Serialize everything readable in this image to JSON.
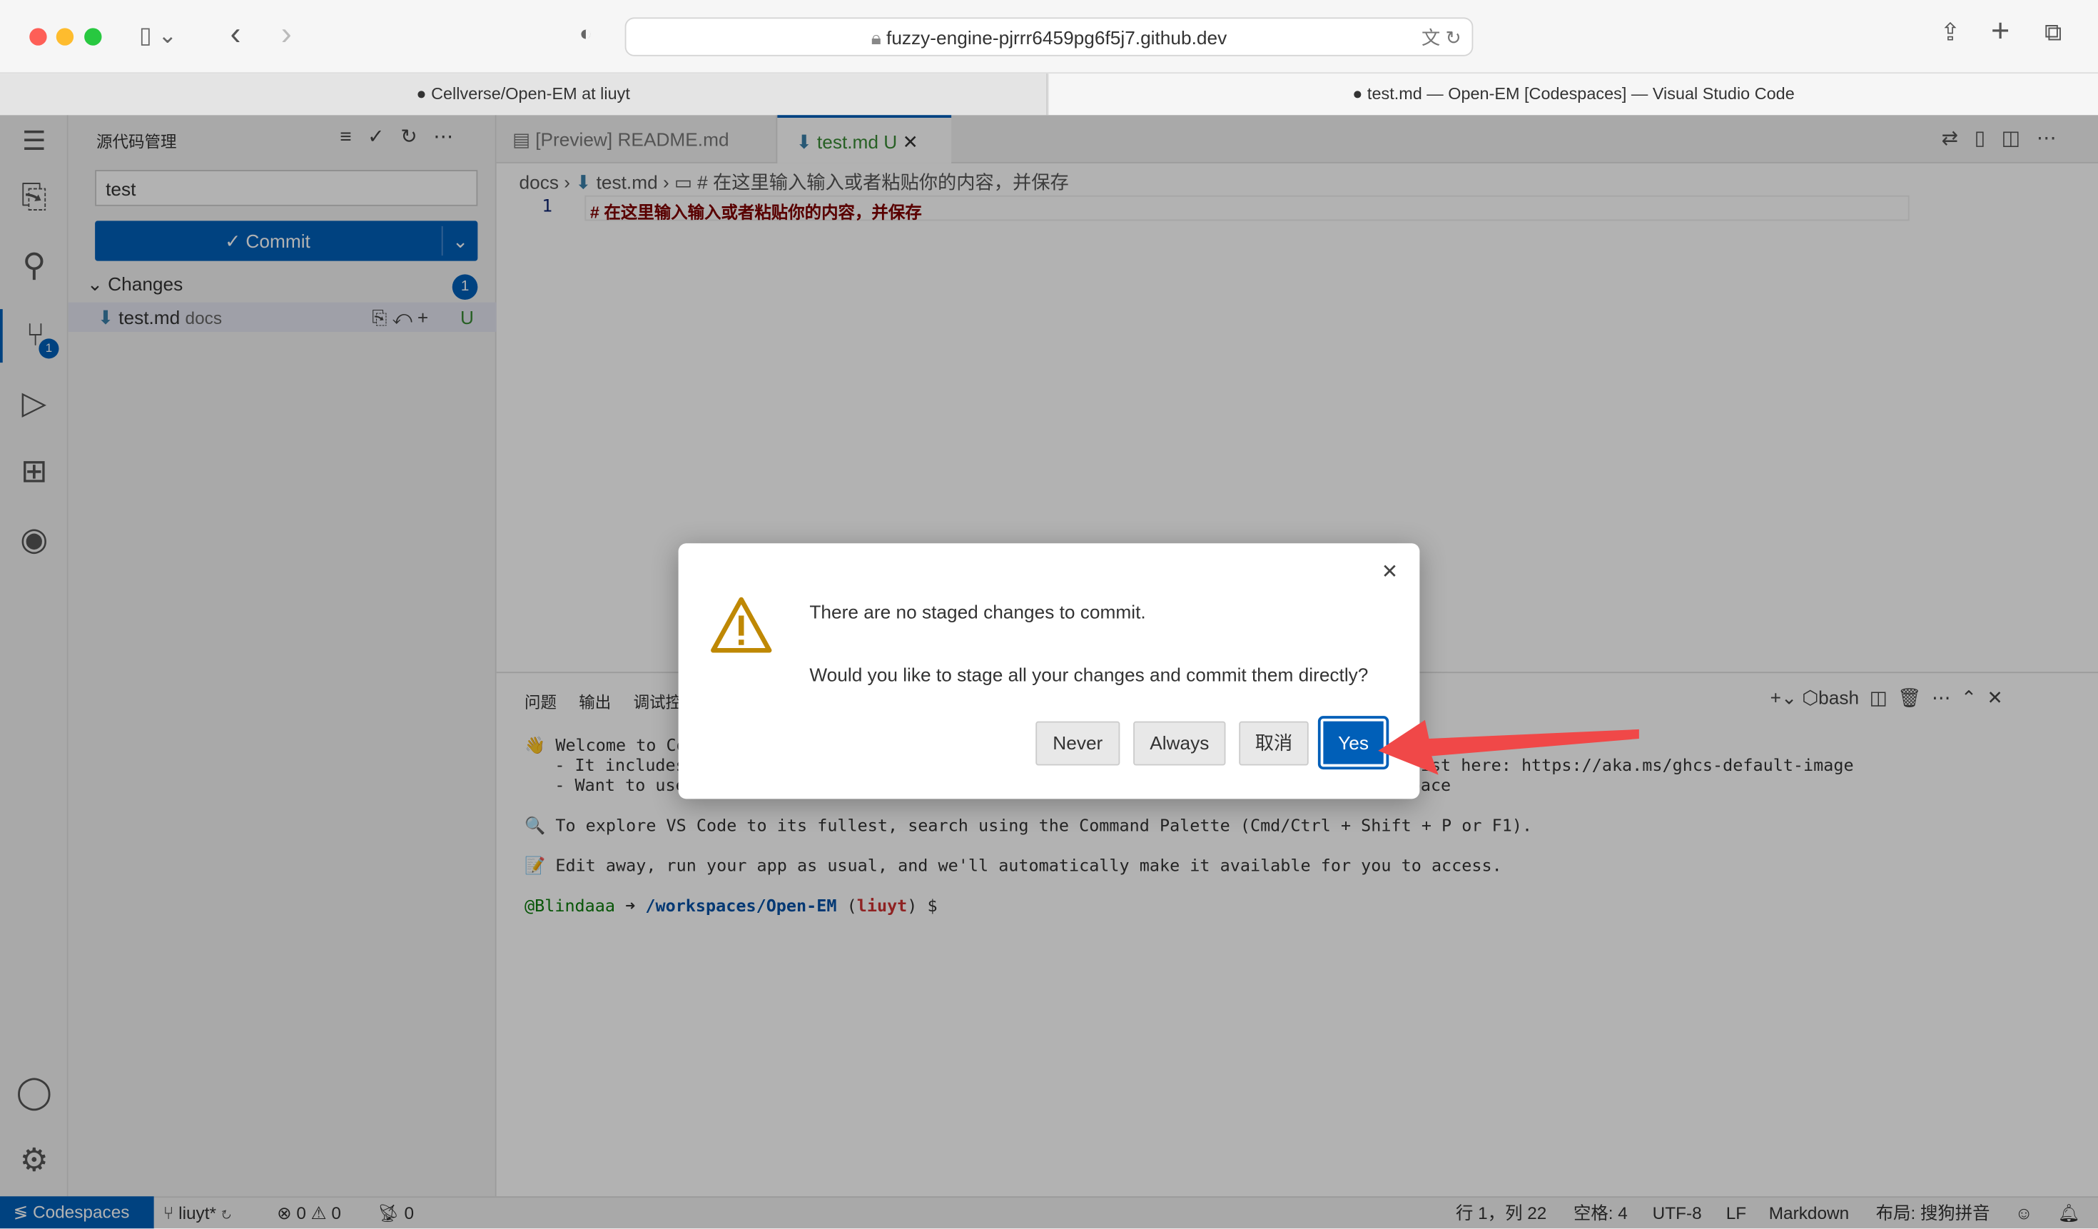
{
  "browser": {
    "url": "fuzzy-engine-pjrrr6459pg6f5j7.github.dev",
    "tabs": [
      {
        "label": "Cellverse/Open-EM at liuyt",
        "active": false
      },
      {
        "label": "test.md — Open-EM [Codespaces] — Visual Studio Code",
        "active": true
      }
    ]
  },
  "activity_bar": {
    "items": [
      "menu-icon",
      "explorer-icon",
      "search-icon",
      "source-control-icon",
      "run-debug-icon",
      "extensions-icon",
      "github-icon"
    ],
    "scm_badge": "1",
    "bottom": [
      "account-icon",
      "settings-gear-icon"
    ]
  },
  "sidebar": {
    "title": "源代码管理",
    "commit_message": "test",
    "commit_label": "✓ Commit",
    "changes_label": "Changes",
    "changes_count": "1",
    "files": [
      {
        "name": "test.md",
        "folder": "docs",
        "status": "U"
      }
    ]
  },
  "editor": {
    "tabs": [
      {
        "label": "[Preview] README.md",
        "active": false
      },
      {
        "label": "test.md",
        "status": "U",
        "active": true
      }
    ],
    "breadcrumb": [
      "docs",
      "test.md",
      "# 在这里输入输入或者粘贴你的内容，并保存"
    ],
    "lines": [
      {
        "num": "1",
        "text": "# 在这里输入输入或者粘贴你的内容，并保存"
      }
    ]
  },
  "panel": {
    "tabs": [
      "问题",
      "输出",
      "调试控制台"
    ],
    "shell": "bash",
    "terminal": [
      {
        "icon": "👋",
        "text": "Welcome to Codespaces! You are on our default image."
      },
      {
        "text": "   - It includes runtimes and tools for Python, Node.js, Docker, and more. See the full list here: https://aka.ms/ghcs-default-image"
      },
      {
        "text": "   - Want to use a custom image instead? Learn more here: https://aka.ms/configure-codespace"
      },
      {
        "text": ""
      },
      {
        "icon": "🔍",
        "text": "To explore VS Code to its fullest, search using the Command Palette (Cmd/Ctrl + Shift + P or F1)."
      },
      {
        "text": ""
      },
      {
        "icon": "📝",
        "text": "Edit away, run your app as usual, and we'll automatically make it available for you to access."
      }
    ],
    "prompt": {
      "user": "@Blindaaa",
      "arrow": "➜",
      "path": "/workspaces/Open-EM",
      "branch": "liuyt",
      "symbol": "$"
    }
  },
  "dialog": {
    "message": "There are no staged changes to commit.",
    "detail": "Would you like to stage all your changes and commit them directly?",
    "buttons": [
      "Never",
      "Always",
      "取消",
      "Yes"
    ],
    "primary": "Yes"
  },
  "status_bar": {
    "remote": "Codespaces",
    "branch": "liuyt*",
    "errors": "0",
    "warnings": "0",
    "ports": "0",
    "position": "行 1，列 22",
    "spaces": "空格: 4",
    "encoding": "UTF-8",
    "eol": "LF",
    "language": "Markdown",
    "layout": "布局: 搜狗拼音"
  },
  "colors": {
    "accent": "#0060c0",
    "arrow": "#f04848",
    "warning": "#bf8803"
  }
}
